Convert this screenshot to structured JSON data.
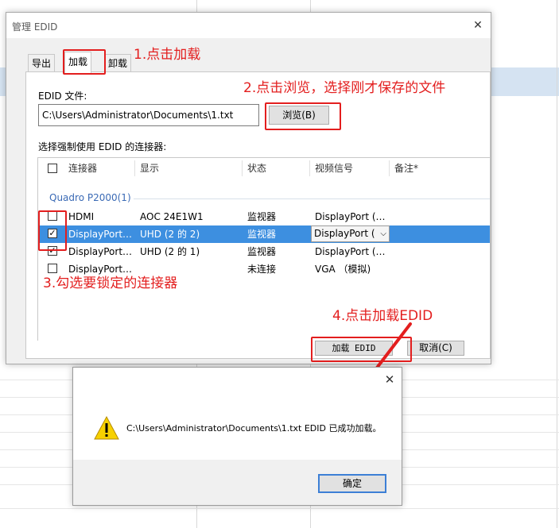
{
  "dialog": {
    "title": "管理 EDID",
    "close_glyph": "✕",
    "tabs": [
      {
        "label": "导出"
      },
      {
        "label": "加载"
      },
      {
        "label": "卸载"
      }
    ],
    "edid_file_label": "EDID 文件:",
    "edid_file_path": "C:\\Users\\Administrator\\Documents\\1.txt",
    "browse_label": "浏览(B)",
    "select_label": "选择强制使用 EDID 的连接器:",
    "columns": [
      "连接器",
      "显示",
      "状态",
      "视频信号",
      "备注*"
    ],
    "group": "Quadro P2000(1)",
    "rows": [
      {
        "checked": false,
        "connector": "HDMI",
        "display": "AOC 24E1W1",
        "status": "监视器",
        "signal": "DisplayPort (…"
      },
      {
        "checked": true,
        "connector": "DisplayPort…",
        "display": "UHD (2 的 2)",
        "status": "监视器",
        "signal": "DisplayPort (…"
      },
      {
        "checked": true,
        "connector": "DisplayPort…",
        "display": "UHD (2 的 1)",
        "status": "监视器",
        "signal": "DisplayPort (…"
      },
      {
        "checked": false,
        "connector": "DisplayPort…",
        "display": "",
        "status": "未连接",
        "signal": "VGA （模拟)"
      }
    ],
    "combo_value": "DisplayPort (",
    "load_button": "加载 EDID",
    "cancel_button": "取消(C)"
  },
  "annotations": {
    "step1": "1.点击加载",
    "step2": "2.点击浏览，选择刚才保存的文件",
    "step3": "3.勾选要锁定的连接器",
    "step4": "4.点击加载EDID",
    "color": "#e31e1e"
  },
  "message_box": {
    "text": "C:\\Users\\Administrator\\Documents\\1.txt EDID 已成功加载。",
    "icon": "warning-icon",
    "ok_label": "确定",
    "close_glyph": "✕"
  }
}
